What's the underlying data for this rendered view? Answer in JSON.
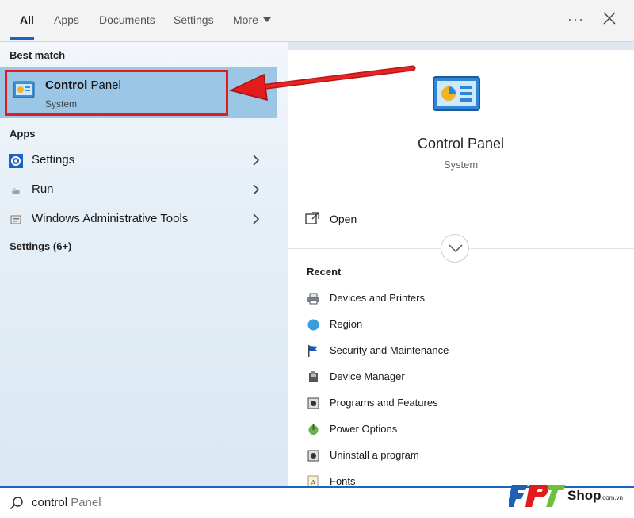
{
  "tabs": [
    {
      "label": "All",
      "active": true
    },
    {
      "label": "Apps"
    },
    {
      "label": "Documents"
    },
    {
      "label": "Settings"
    },
    {
      "label": "More"
    }
  ],
  "window_controls": {
    "options_icon": "more-options-icon",
    "close_icon": "close-icon"
  },
  "left": {
    "best_match_heading": "Best match",
    "best_match": {
      "title_bold": "Control",
      "title_rest": " Panel",
      "subtitle": "System",
      "icon": "control-panel-icon"
    },
    "apps_heading": "Apps",
    "apps": [
      {
        "label": "Settings",
        "icon": "gear-icon"
      },
      {
        "label": "Run",
        "icon": "run-icon"
      },
      {
        "label": "Windows Administrative Tools",
        "icon": "admin-tools-icon"
      }
    ],
    "settings_heading": "Settings (6+)"
  },
  "right": {
    "title": "Control Panel",
    "subtitle": "System",
    "open_label": "Open",
    "recent_heading": "Recent",
    "recent": [
      {
        "label": "Devices and Printers",
        "icon": "printer-icon"
      },
      {
        "label": "Region",
        "icon": "globe-icon"
      },
      {
        "label": "Security and Maintenance",
        "icon": "flag-icon"
      },
      {
        "label": "Device Manager",
        "icon": "device-manager-icon"
      },
      {
        "label": "Programs and Features",
        "icon": "programs-icon"
      },
      {
        "label": "Power Options",
        "icon": "power-icon"
      },
      {
        "label": "Uninstall a program",
        "icon": "uninstall-icon"
      },
      {
        "label": "Fonts",
        "icon": "fonts-icon"
      }
    ]
  },
  "search": {
    "typed": "control",
    "suggestion": " Panel",
    "icon": "search-icon"
  },
  "watermark": {
    "brand": "FPT",
    "text": "Shop",
    "suffix": ".com.vn"
  },
  "colors": {
    "accent": "#1a64c8",
    "highlight": "#9cc6e6",
    "annotation": "#e21b1b"
  }
}
